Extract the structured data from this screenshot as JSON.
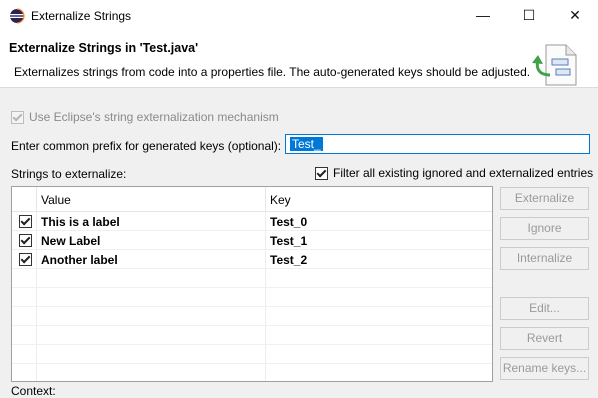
{
  "window": {
    "title": "Externalize Strings",
    "minimize_glyph": "—",
    "maximize_glyph": "☐",
    "close_glyph": "✕"
  },
  "header": {
    "title": "Externalize Strings in 'Test.java'",
    "description": "Externalizes strings from code into a properties file. The auto-generated keys should be adjusted."
  },
  "options": {
    "use_eclipse_label": "Use Eclipse's string externalization mechanism",
    "use_eclipse_checked": true,
    "use_eclipse_enabled": false,
    "prefix_label": "Enter common prefix for generated keys (optional):",
    "prefix_value": "Test_",
    "strings_label": "Strings to externalize:",
    "filter_label": "Filter all existing ignored and externalized entries",
    "filter_checked": true
  },
  "table": {
    "columns": [
      "Value",
      "Key"
    ],
    "rows": [
      {
        "value": "This is a label",
        "key": "Test_0",
        "checked": true
      },
      {
        "value": "New Label",
        "key": "Test_1",
        "checked": true
      },
      {
        "value": "Another label",
        "key": "Test_2",
        "checked": true
      }
    ]
  },
  "buttons": {
    "externalize": "Externalize",
    "ignore": "Ignore",
    "internalize": "Internalize",
    "edit": "Edit...",
    "revert": "Revert",
    "rename_keys": "Rename keys..."
  },
  "context_label": "Context:",
  "icons": {
    "app": "eclipse-icon",
    "header": "externalize-wizard-icon"
  },
  "colors": {
    "selection": "#0078d7",
    "focus_border": "#0078d7",
    "disabled_text": "#9a9a9a"
  }
}
